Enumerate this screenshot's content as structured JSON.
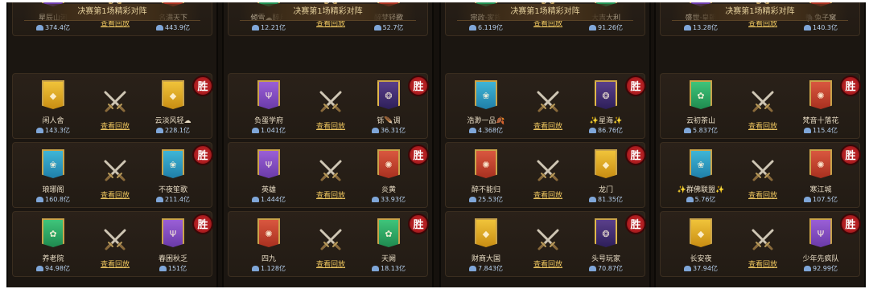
{
  "panels": [
    {
      "title": "决赛第1场精彩对阵",
      "matches": [
        {
          "left": {
            "name": "星辰山河",
            "power": "374.4亿",
            "banner": "purple",
            "emblem": "✦"
          },
          "right": {
            "name": "名满天下",
            "power": "443.9亿",
            "banner": "red",
            "emblem": "✺"
          },
          "winner": "",
          "replay": "查看回放"
        },
        {
          "left": {
            "name": "闲人舍",
            "power": "143.3亿",
            "banner": "gold",
            "emblem": "◆"
          },
          "right": {
            "name": "云淡风轻☁",
            "power": "228.1亿",
            "banner": "gold",
            "emblem": "◆"
          },
          "winner": "right",
          "replay": "查看回放"
        },
        {
          "left": {
            "name": "琅琊阁",
            "power": "160.8亿",
            "banner": "teal",
            "emblem": "❀"
          },
          "right": {
            "name": "不夜笙歌",
            "power": "211.4亿",
            "banner": "teal",
            "emblem": "❀"
          },
          "winner": "right",
          "replay": "查看回放"
        },
        {
          "left": {
            "name": "养老院",
            "power": "94.98亿",
            "banner": "green",
            "emblem": "✿"
          },
          "right": {
            "name": "春困秋乏",
            "power": "151亿",
            "banner": "purple",
            "emblem": "Ψ"
          },
          "winner": "right",
          "replay": "查看回放"
        }
      ]
    },
    {
      "title": "决赛第1场精彩对阵",
      "matches": [
        {
          "left": {
            "name": "倾雪☁醉月",
            "power": "12.21亿",
            "banner": "green",
            "emblem": "✿"
          },
          "right": {
            "name": "醉梦轻歌",
            "power": "52.7亿",
            "banner": "red",
            "emblem": "✺"
          },
          "winner": "",
          "replay": "查看回放"
        },
        {
          "left": {
            "name": "负蛋学府",
            "power": "1.041亿",
            "banner": "purple",
            "emblem": "Ψ"
          },
          "right": {
            "name": "铄🪶调",
            "power": "36.31亿",
            "banner": "special",
            "emblem": "❂"
          },
          "winner": "right",
          "replay": "查看回放"
        },
        {
          "left": {
            "name": "英雄",
            "power": "1.444亿",
            "banner": "purple",
            "emblem": "Ψ"
          },
          "right": {
            "name": "炎黄",
            "power": "33.93亿",
            "banner": "red",
            "emblem": "✺"
          },
          "winner": "right",
          "replay": "查看回放"
        },
        {
          "left": {
            "name": "四九",
            "power": "1.128亿",
            "banner": "red",
            "emblem": "✺"
          },
          "right": {
            "name": "天阙",
            "power": "18.13亿",
            "banner": "green",
            "emblem": "✿"
          },
          "winner": "right",
          "replay": "查看回放"
        }
      ]
    },
    {
      "title": "决赛第1场精彩对阵",
      "matches": [
        {
          "left": {
            "name": "宗政·家族",
            "power": "6.119亿",
            "banner": "green",
            "emblem": "✿"
          },
          "right": {
            "name": "大吉大利",
            "power": "91.26亿",
            "banner": "green",
            "emblem": "✿"
          },
          "winner": "",
          "replay": "查看回放"
        },
        {
          "left": {
            "name": "浩渺一品🍂",
            "power": "4.368亿",
            "banner": "teal",
            "emblem": "❀"
          },
          "right": {
            "name": "✨星海✨",
            "power": "86.76亿",
            "banner": "special",
            "emblem": "❂"
          },
          "winner": "right",
          "replay": "查看回放"
        },
        {
          "left": {
            "name": "醉不能归",
            "power": "25.53亿",
            "banner": "red",
            "emblem": "✺"
          },
          "right": {
            "name": "龙门",
            "power": "81.35亿",
            "banner": "gold",
            "emblem": "◆"
          },
          "winner": "right",
          "replay": "查看回放"
        },
        {
          "left": {
            "name": "财商大国",
            "power": "7.843亿",
            "banner": "gold",
            "emblem": "◆"
          },
          "right": {
            "name": "头号玩家",
            "power": "70.87亿",
            "banner": "special",
            "emblem": "❂"
          },
          "winner": "right",
          "replay": "查看回放"
        }
      ]
    },
    {
      "title": "决赛第1场精彩对阵",
      "matches": [
        {
          "left": {
            "name": "盛世·皇朝",
            "power": "13.28亿",
            "banner": "purple",
            "emblem": "Ψ"
          },
          "right": {
            "name": "🐘兔子窝",
            "power": "140.3亿",
            "banner": "red",
            "emblem": "✺"
          },
          "winner": "",
          "replay": "查看回放"
        },
        {
          "left": {
            "name": "云初茶山",
            "power": "5.837亿",
            "banner": "green",
            "emblem": "✿"
          },
          "right": {
            "name": "梵音十落花",
            "power": "115.4亿",
            "banner": "red",
            "emblem": "✺"
          },
          "winner": "right",
          "replay": "查看回放"
        },
        {
          "left": {
            "name": "✨群佛联盟✨",
            "power": "5.76亿",
            "banner": "teal",
            "emblem": "❀"
          },
          "right": {
            "name": "寒江城",
            "power": "107.5亿",
            "banner": "red",
            "emblem": "✺"
          },
          "winner": "right",
          "replay": "查看回放"
        },
        {
          "left": {
            "name": "长安夜",
            "power": "37.94亿",
            "banner": "gold",
            "emblem": "◆"
          },
          "right": {
            "name": "少年先疯队",
            "power": "92.99亿",
            "banner": "purple",
            "emblem": "Ψ"
          },
          "winner": "right",
          "replay": "查看回放"
        }
      ]
    }
  ],
  "win_label": "胜",
  "colors": {
    "accent_gold": "#ecc45e",
    "win_red": "#b41f22",
    "power_blue": "#b8d2f0"
  }
}
